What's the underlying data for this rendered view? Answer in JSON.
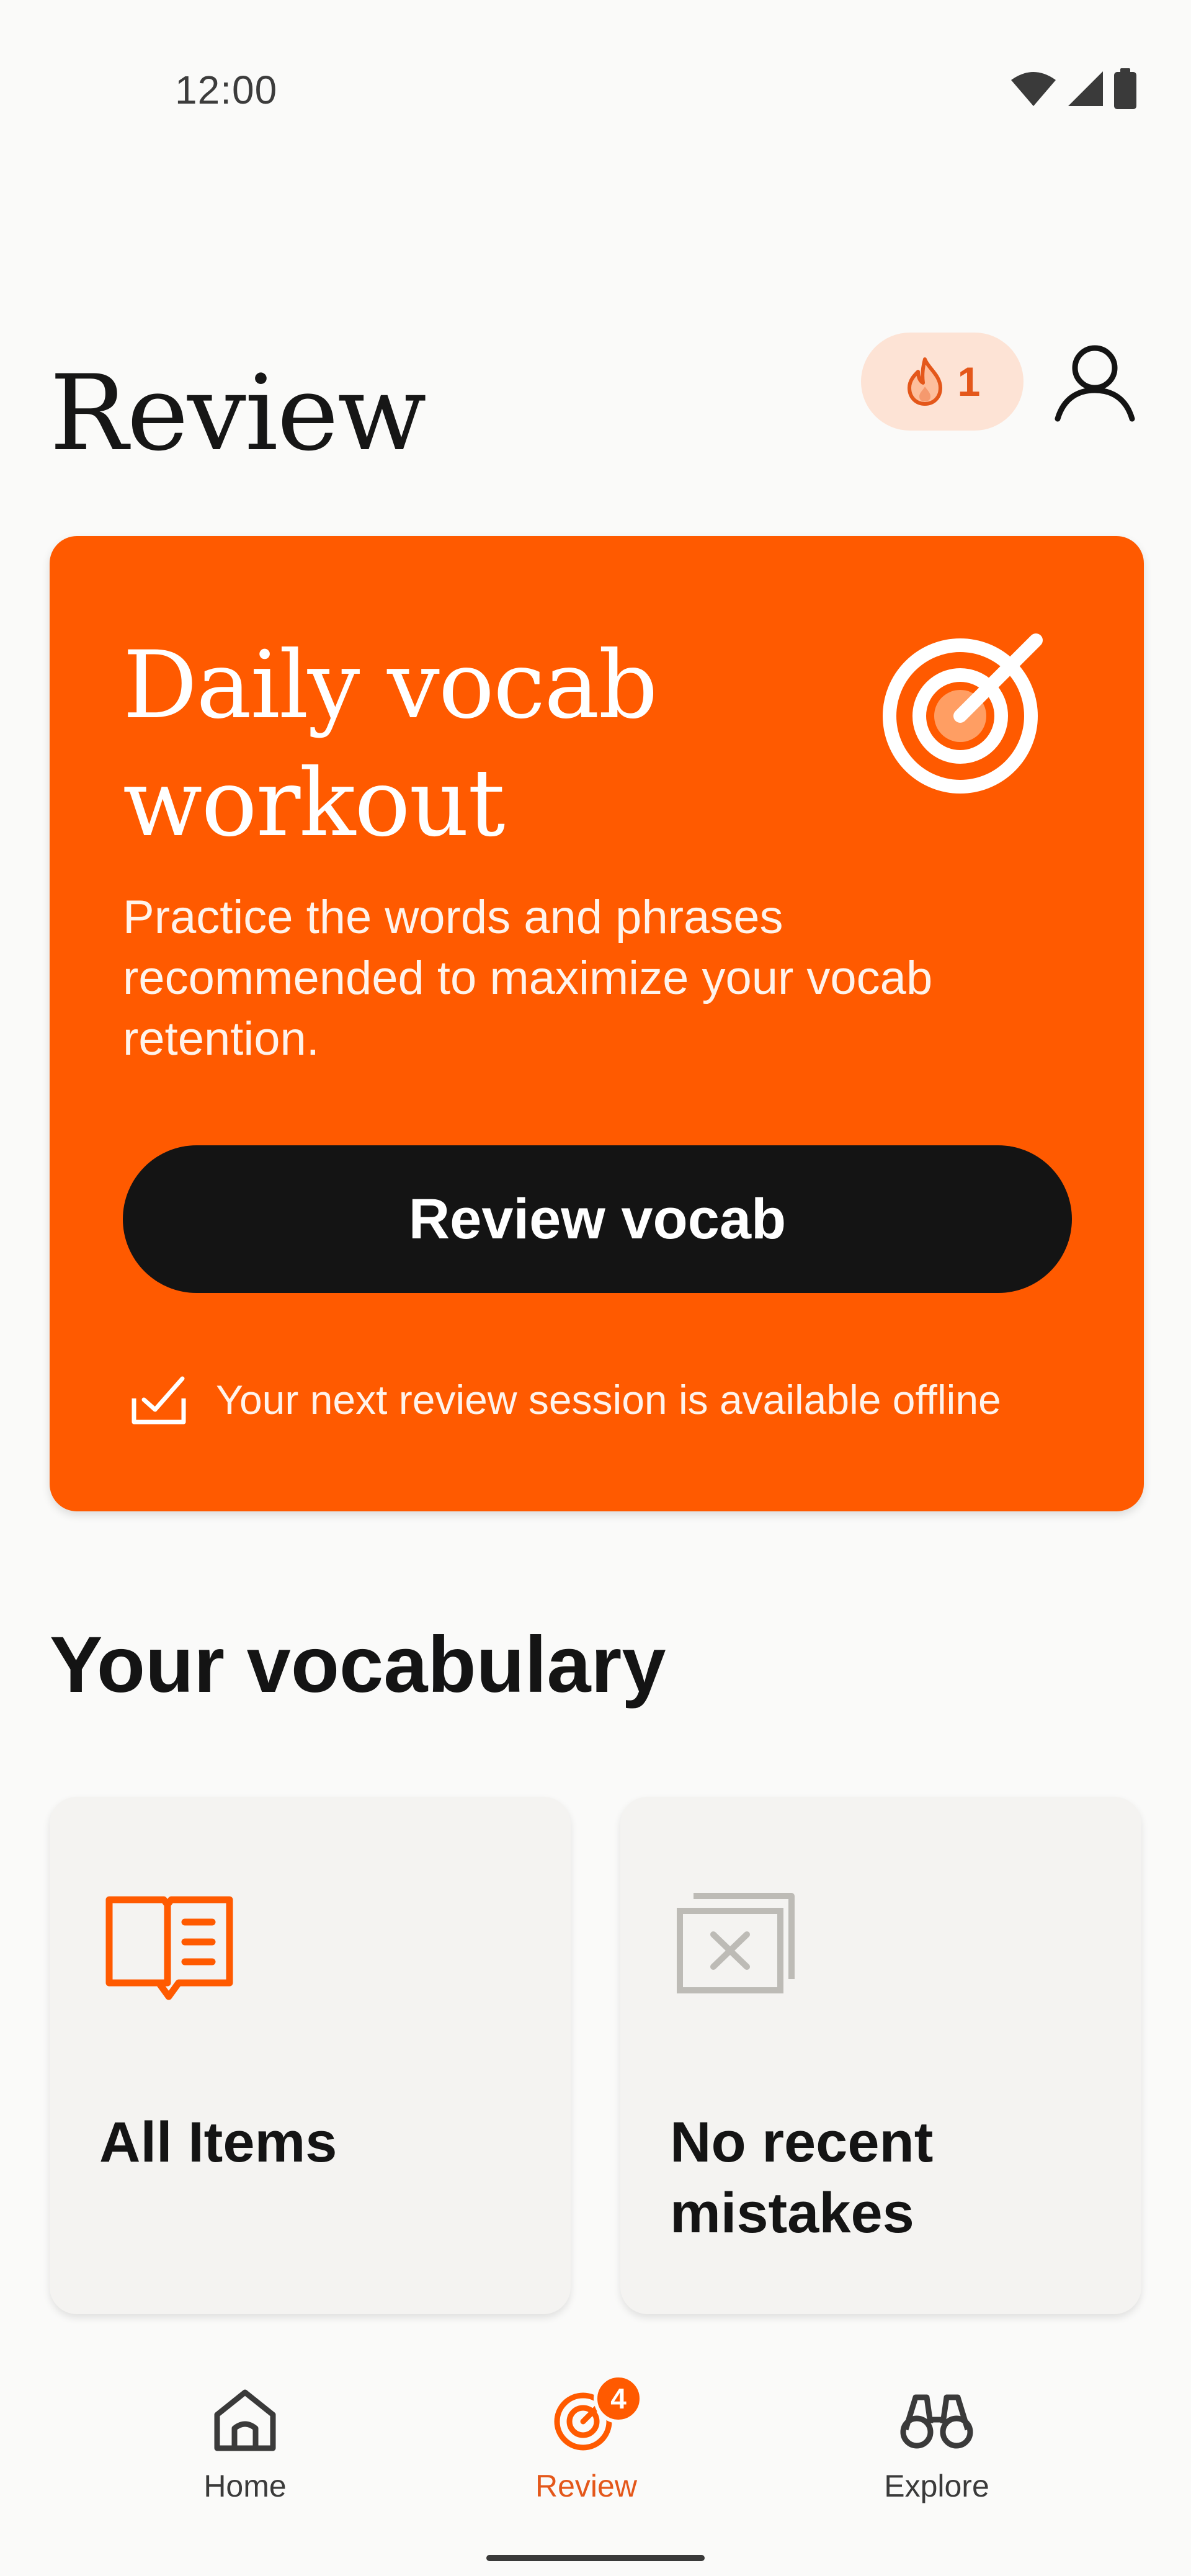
{
  "status_bar": {
    "time": "12:00",
    "icons": [
      "wifi-icon",
      "cellular-signal-icon",
      "battery-icon"
    ]
  },
  "header": {
    "title": "Review",
    "streak_count": "1",
    "streak_icon": "flame-icon",
    "profile_icon": "user-icon"
  },
  "workout_card": {
    "title": "Daily vocab workout",
    "description": "Practice the words and phrases recommended to maximize your vocab retention.",
    "button_label": "Review vocab",
    "offline_note": "Your next review session is available offline",
    "icon": "target-icon",
    "offline_icon": "checked-tray-icon"
  },
  "vocabulary": {
    "section_title": "Your vocabulary",
    "tiles": [
      {
        "label": "All Items",
        "icon": "open-book-icon"
      },
      {
        "label": "No recent mistakes",
        "icon": "mistakes-cards-icon"
      }
    ]
  },
  "bottom_nav": {
    "items": [
      {
        "label": "Home",
        "icon": "home-icon",
        "active": false
      },
      {
        "label": "Review",
        "icon": "target-icon",
        "active": true,
        "badge": "4"
      },
      {
        "label": "Explore",
        "icon": "binoculars-icon",
        "active": false
      }
    ]
  },
  "colors": {
    "accent": "#FF5A00",
    "accent_text": "#E4571A",
    "streak_bg": "#FDE3D5",
    "button_bg": "#141414",
    "tile_bg": "#F4F3F1",
    "page_bg": "#FAFAF9"
  }
}
